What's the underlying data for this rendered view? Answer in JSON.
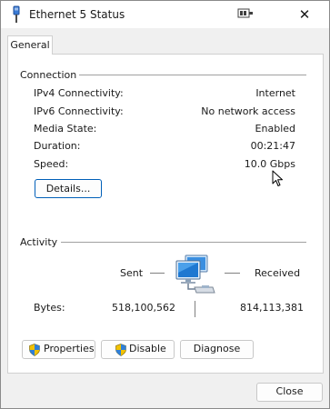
{
  "window": {
    "title": "Ethernet 5 Status",
    "icon": "network-adapter-icon",
    "close_glyph": "✕"
  },
  "tabs": [
    {
      "label": "General",
      "selected": true
    }
  ],
  "connection": {
    "section_label": "Connection",
    "rows": [
      {
        "label": "IPv4 Connectivity:",
        "value": "Internet"
      },
      {
        "label": "IPv6 Connectivity:",
        "value": "No network access"
      },
      {
        "label": "Media State:",
        "value": "Enabled"
      },
      {
        "label": "Duration:",
        "value": "00:21:47"
      },
      {
        "label": "Speed:",
        "value": "10.0 Gbps"
      }
    ],
    "details_button": "Details..."
  },
  "activity": {
    "section_label": "Activity",
    "sent_label": "Sent",
    "received_label": "Received",
    "bytes_label": "Bytes:",
    "bytes_sent": "518,100,562",
    "bytes_received": "814,113,381"
  },
  "buttons": {
    "properties": "Properties",
    "disable": "Disable",
    "diagnose": "Diagnose",
    "close": "Close"
  },
  "colors": {
    "accent": "#005fb8",
    "window_bg": "#f0f0f0",
    "panel_bg": "#ffffff"
  }
}
